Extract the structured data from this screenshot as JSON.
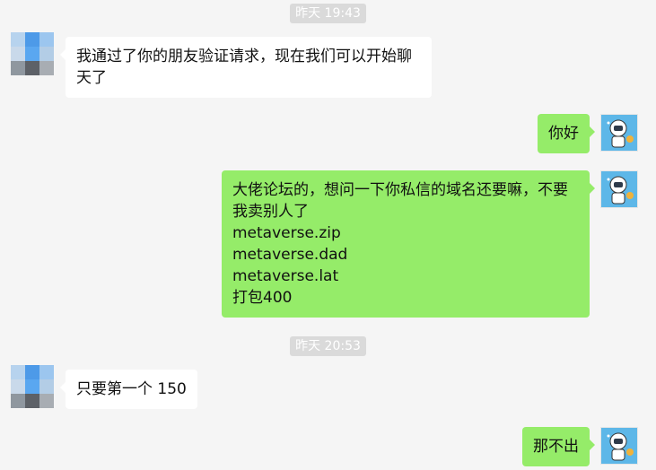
{
  "colors": {
    "background": "#f5f5f5",
    "bubble_self": "#95ec69",
    "bubble_other": "#ffffff",
    "timestamp_bg": "#dadada"
  },
  "timestamps": [
    "昨天 19:43",
    "昨天 20:53"
  ],
  "messages": [
    {
      "from": "other",
      "text": "我通过了你的朋友验证请求，现在我们可以开始聊\n天了"
    },
    {
      "from": "self",
      "text": "你好"
    },
    {
      "from": "self",
      "text": "大佬论坛的，想问一下你私信的域名还要嘛，不要\n我卖别人了\nmetaverse.zip\nmetaverse.dad\nmetaverse.lat\n打包400"
    },
    {
      "from": "other",
      "text": "只要第一个 150"
    },
    {
      "from": "self",
      "text": "那不出"
    }
  ],
  "avatars": {
    "other": "pixelated-avatar",
    "self": "astronaut-avatar"
  }
}
